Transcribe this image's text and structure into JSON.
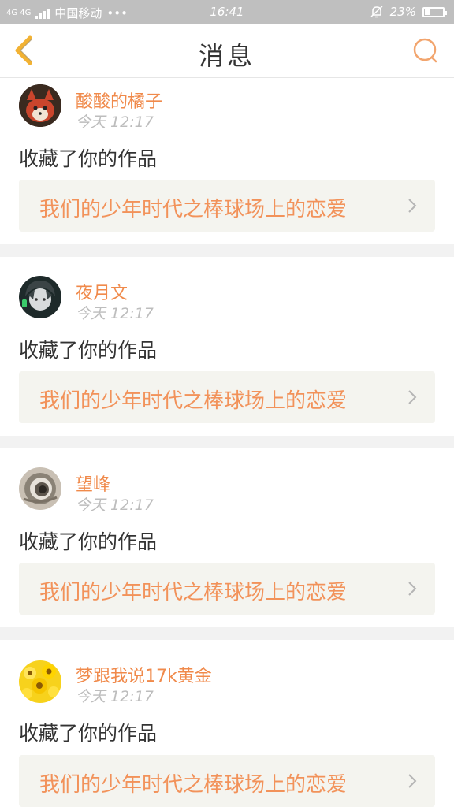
{
  "status_bar": {
    "network_label": "4G 4G",
    "carrier": "中国移动",
    "more_dots": "•••",
    "time": "16:41",
    "battery_percent": "23%"
  },
  "header": {
    "title": "消息",
    "back_icon": "chevron-left-icon",
    "search_icon": "search-icon"
  },
  "colors": {
    "accent": "#f08a4b",
    "header_bg": "#ffffff",
    "page_bg": "#f2f2f2",
    "link_bg": "#f4f4ef"
  },
  "messages": [
    {
      "username": "酸酸的橘子",
      "time": "今天 12:17",
      "action": "收藏了你的作品",
      "work_title": "我们的少年时代之棒球场上的恋爱",
      "avatar": "fox-avatar"
    },
    {
      "username": "夜月文",
      "time": "今天 12:17",
      "action": "收藏了你的作品",
      "work_title": "我们的少年时代之棒球场上的恋爱",
      "avatar": "anime-boy-avatar"
    },
    {
      "username": "望峰",
      "time": "今天 12:17",
      "action": "收藏了你的作品",
      "work_title": "我们的少年时代之棒球场上的恋爱",
      "avatar": "spiral-avatar"
    },
    {
      "username": "梦跟我说17k黄金",
      "time": "今天 12:17",
      "action": "收藏了你的作品",
      "work_title": "我们的少年时代之棒球场上的恋爱",
      "avatar": "sunflower-avatar"
    }
  ]
}
